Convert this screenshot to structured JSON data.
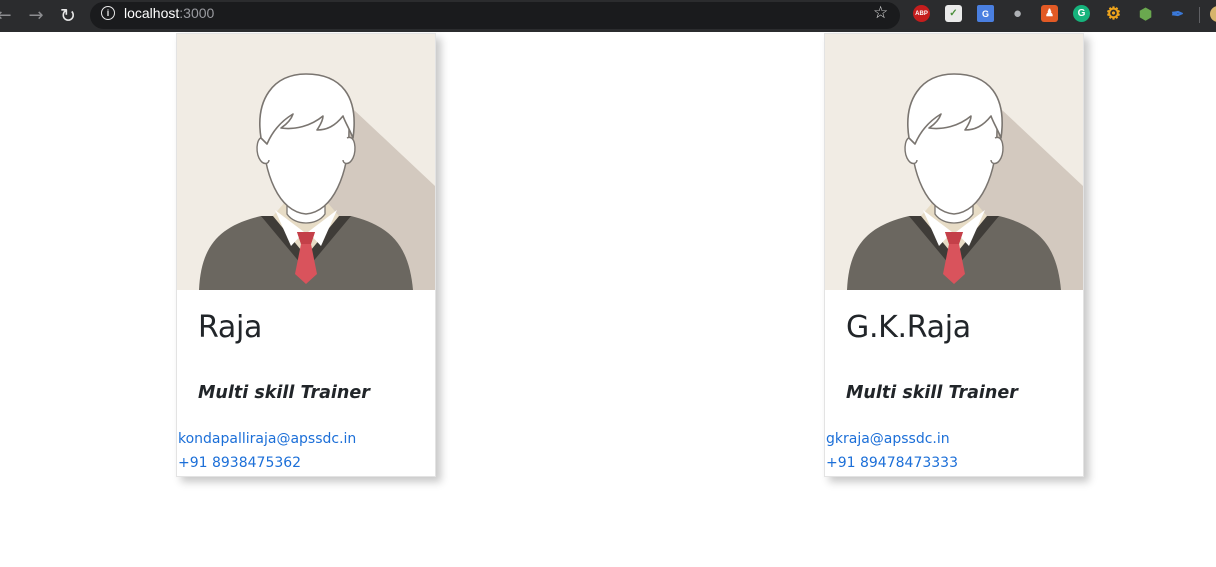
{
  "browser": {
    "url_host": "localhost",
    "url_port": ":3000",
    "extensions": [
      {
        "name": "adblock-plus",
        "label": "ABP"
      },
      {
        "name": "mail"
      },
      {
        "name": "google-translate",
        "label": "G"
      },
      {
        "name": "globe"
      },
      {
        "name": "person"
      },
      {
        "name": "grammarly",
        "label": "G"
      },
      {
        "name": "gear"
      },
      {
        "name": "nodejs"
      },
      {
        "name": "feather"
      },
      {
        "name": "profile"
      }
    ]
  },
  "colors": {
    "link": "#1c6fd8",
    "text": "#212529",
    "avatar_bg": "#f1ece4",
    "avatar_shadow": "#d3c9bf",
    "sweater": "#6b6760",
    "tie": "#d9535c",
    "chrome_bg": "#2b2c2e"
  },
  "cards": [
    {
      "name": "Raja",
      "role": "Multi skill Trainer",
      "email": "kondapalliraja@apssdc.in",
      "phone": "+91 8938475362"
    },
    {
      "name": "G.K.Raja",
      "role": "Multi skill Trainer",
      "email": "gkraja@apssdc.in",
      "phone": "+91 89478473333"
    }
  ]
}
